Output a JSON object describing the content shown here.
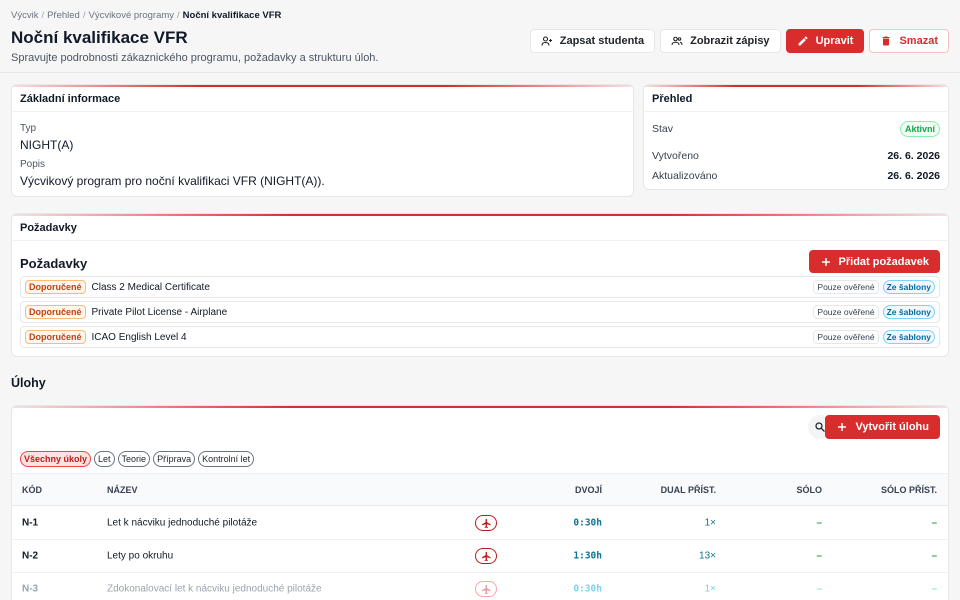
{
  "breadcrumb": [
    "Výcvik",
    "Přehled",
    "Výcvikové programy",
    "Noční kvalifikace VFR"
  ],
  "header": {
    "title": "Noční kvalifikace VFR",
    "subtitle": "Spravujte podrobnosti zákaznického programu, požadavky a strukturu úloh."
  },
  "actions": {
    "enroll": "Zapsat studenta",
    "view_enrollments": "Zobrazit zápisy",
    "edit": "Upravit",
    "delete": "Smazat"
  },
  "basic_info": {
    "heading": "Základní informace",
    "type_label": "Typ",
    "type_value": "NIGHT(A)",
    "desc_label": "Popis",
    "desc_value": "Výcvikový program pro noční kvalifikaci VFR (NIGHT(A))."
  },
  "overview": {
    "heading": "Přehled",
    "status_label": "Stav",
    "status_value": "Aktivní",
    "created_label": "Vytvořeno",
    "created_value": "26. 6. 2026",
    "updated_label": "Aktualizováno",
    "updated_value": "26. 6. 2026"
  },
  "requirements": {
    "card_heading": "Požadavky",
    "title": "Požadavky",
    "add_button": "Přidat požadavek",
    "items": [
      {
        "tag": "Doporučené",
        "name": "Class 2 Medical Certificate",
        "verified": "Pouze ověřené",
        "source": "Ze šablony"
      },
      {
        "tag": "Doporučené",
        "name": "Private Pilot License - Airplane",
        "verified": "Pouze ověřené",
        "source": "Ze šablony"
      },
      {
        "tag": "Doporučené",
        "name": "ICAO English Level 4",
        "verified": "Pouze ověřené",
        "source": "Ze šablony"
      }
    ]
  },
  "tasks": {
    "section_title": "Úlohy",
    "create_button": "Vytvořit úlohu",
    "filters": [
      "Všechny úkoly",
      "Let",
      "Teorie",
      "Příprava",
      "Kontrolní let"
    ],
    "columns": {
      "code": "KÓD",
      "name": "NÁZEV",
      "dual": "DVOJÍ",
      "dual_count": "DUAL PŘÍST.",
      "solo": "SÓLO",
      "solo_count": "SÓLO PŘÍST."
    },
    "rows": [
      {
        "code": "N-1",
        "name": "Let k nácviku jednoduché pilotáže",
        "dual": "0:30h",
        "dual_count": "1×",
        "solo": "–",
        "solo_count": "–"
      },
      {
        "code": "N-2",
        "name": "Lety po okruhu",
        "dual": "1:30h",
        "dual_count": "13×",
        "solo": "–",
        "solo_count": "–"
      },
      {
        "code": "N-3",
        "name": "Zdokonalovací let k nácviku jednoduché pilotáže",
        "dual": "0:30h",
        "dual_count": "1×",
        "solo": "–",
        "solo_count": "–"
      }
    ]
  },
  "colors": {
    "accent": "#d92d2d",
    "success": "#16a34a",
    "info": "#0e7490"
  }
}
